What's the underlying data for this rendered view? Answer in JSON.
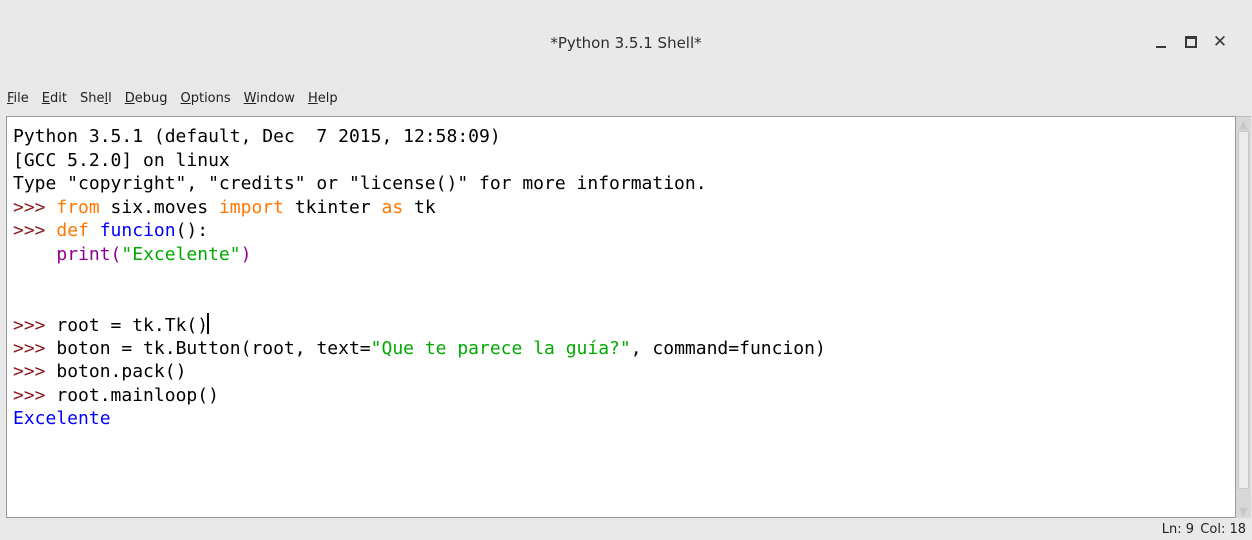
{
  "window": {
    "title": "*Python 3.5.1 Shell*"
  },
  "menu": [
    {
      "pre": "",
      "key": "F",
      "post": "ile"
    },
    {
      "pre": "",
      "key": "E",
      "post": "dit"
    },
    {
      "pre": "She",
      "key": "l",
      "post": "l"
    },
    {
      "pre": "",
      "key": "D",
      "post": "ebug"
    },
    {
      "pre": "",
      "key": "O",
      "post": "ptions"
    },
    {
      "pre": "",
      "key": "W",
      "post": "indow"
    },
    {
      "pre": "",
      "key": "H",
      "post": "elp"
    }
  ],
  "shell": {
    "banner": [
      "Python 3.5.1 (default, Dec  7 2015, 12:58:09)",
      "[GCC 5.2.0] on linux",
      "Type \"copyright\", \"credits\" or \"license()\" for more information."
    ],
    "prompt": ">>> ",
    "indent": "    ",
    "line4": {
      "kw1": "from",
      "t1": " six.moves ",
      "kw2": "import",
      "t2": " tkinter ",
      "kw3": "as",
      "t3": " tk"
    },
    "line5": {
      "kw": "def",
      "sp": " ",
      "name": "funcion",
      "rest": "():"
    },
    "line6": {
      "builtin": "print",
      "open": "(",
      "str": "\"Excelente\"",
      "close": ")"
    },
    "line9": {
      "text": "root = tk.Tk()"
    },
    "line10": {
      "pre": "boton = tk.Button(root, text=",
      "str": "\"Que te parece la guía?\"",
      "post": ", command=funcion)"
    },
    "line11": {
      "text": "boton.pack()"
    },
    "line12": {
      "text": "root.mainloop()"
    },
    "output": "Excelente"
  },
  "status": {
    "ln": "Ln: 9",
    "col": "Col: 18"
  },
  "colors": {
    "prompt": "#8b1a1a",
    "keyword": "#ff7700",
    "definition": "#0000ff",
    "builtin": "#900090",
    "string": "#00aa00",
    "stdout": "#0000ff"
  }
}
